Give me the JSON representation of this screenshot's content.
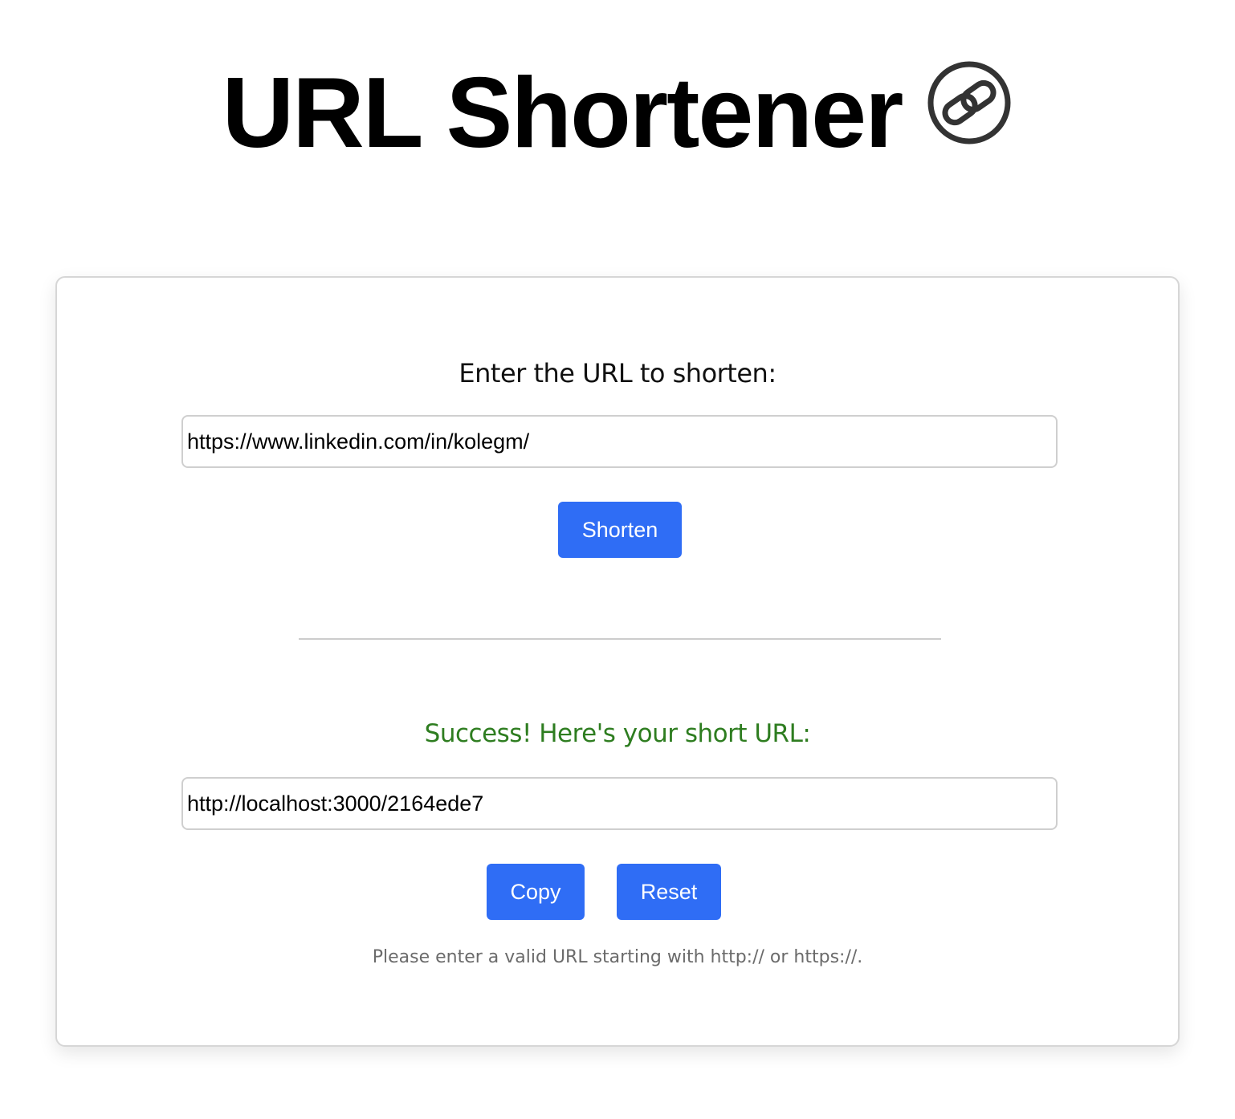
{
  "header": {
    "title": "URL Shortener",
    "logo_icon": "chain-link-icon"
  },
  "form": {
    "prompt_label": "Enter the URL to shorten:",
    "url_input_value": "https://www.linkedin.com/in/kolegm/",
    "shorten_label": "Shorten"
  },
  "result": {
    "success_label": "Success! Here's your short URL:",
    "short_url_value": "http://localhost:3000/2164ede7",
    "copy_label": "Copy",
    "reset_label": "Reset",
    "hint": "Please enter a valid URL starting with http:// or https://."
  },
  "colors": {
    "accent": "#2f6df5",
    "success": "#2e7d20",
    "hint": "#6b6b6b",
    "border": "#cfcfcf"
  }
}
